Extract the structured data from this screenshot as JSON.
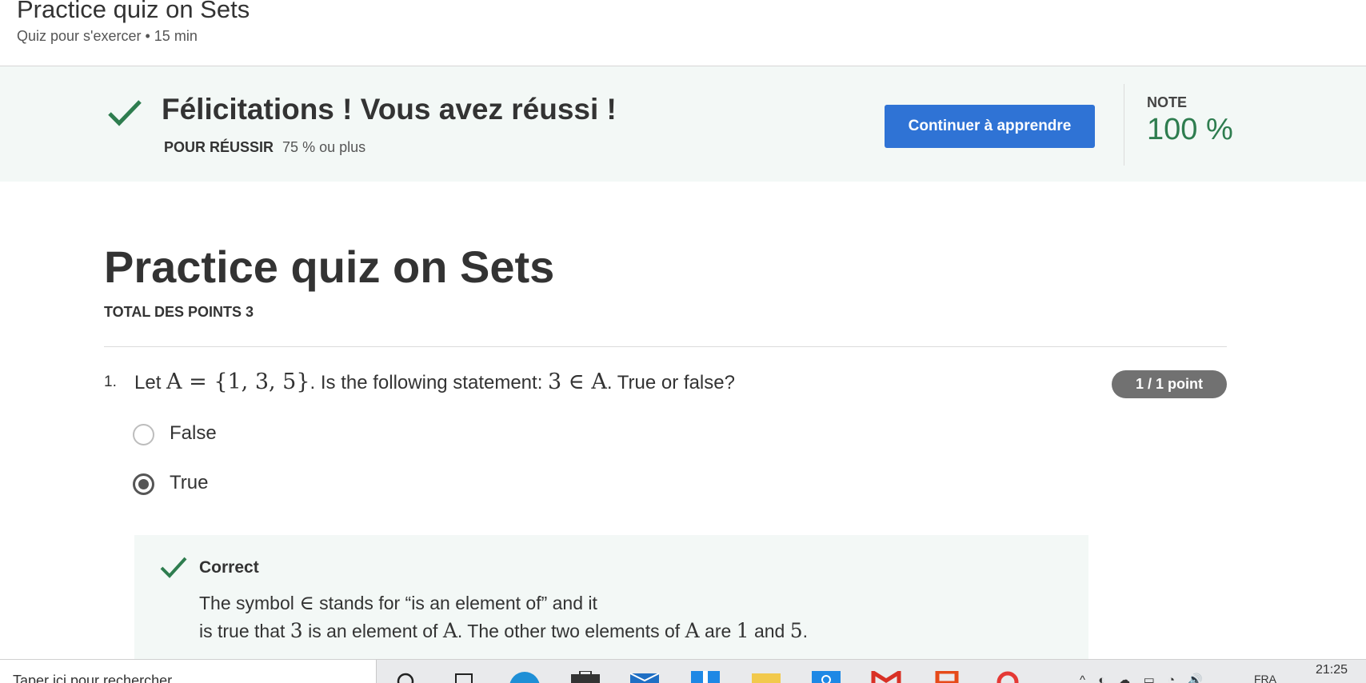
{
  "header": {
    "title": "Practice quiz on Sets",
    "subtitle": "Quiz pour s'exercer • 15 min"
  },
  "banner": {
    "heading": "Félicitations ! Vous avez réussi !",
    "pass_label": "POUR RÉUSSIR",
    "pass_value": "75 % ou plus",
    "continue_label": "Continuer à apprendre",
    "grade_label": "NOTE",
    "grade_value": "100 %"
  },
  "quiz": {
    "title": "Practice quiz on Sets",
    "total_points": "TOTAL DES POINTS 3",
    "questions": [
      {
        "number": "1.",
        "text_before": "Let ",
        "math1": "A = {1, 3, 5}",
        "text_middle": ". Is the following statement:  ",
        "math2": "3 ∈ A",
        "text_after": ".  True or false?",
        "points": "1 / 1 point",
        "options": [
          {
            "label": "False",
            "selected": false
          },
          {
            "label": "True",
            "selected": true
          }
        ],
        "feedback": {
          "title": "Correct",
          "line1_before": "The symbol ",
          "line1_symbol": "∈",
          "line1_after": " stands for “is an element of” and it",
          "line2_a": "is true that ",
          "line2_3": "3",
          "line2_b": " is an element of ",
          "line2_A1": "A",
          "line2_c": ". The other two elements of ",
          "line2_A2": "A",
          "line2_d": " are ",
          "line2_1": "1",
          "line2_e": " and ",
          "line2_5": "5",
          "line2_f": "."
        }
      }
    ]
  },
  "taskbar": {
    "search_placeholder": "Taper ici pour rechercher",
    "tray_text": "^ ◐ ☁ ▭ ◔ 🔊",
    "language": "FRA",
    "time": "21:25"
  },
  "colors": {
    "accent": "#2f73d5",
    "success": "#2e7d4f",
    "banner_bg": "#f3f8f6",
    "badge": "#717171"
  },
  "icons": [
    "check-icon",
    "search-icon",
    "task-view-icon",
    "edge-icon",
    "store-icon",
    "mail-icon",
    "app-icon",
    "folder-icon",
    "store-blue-icon",
    "gmail-icon",
    "office-icon",
    "app-red-icon"
  ]
}
